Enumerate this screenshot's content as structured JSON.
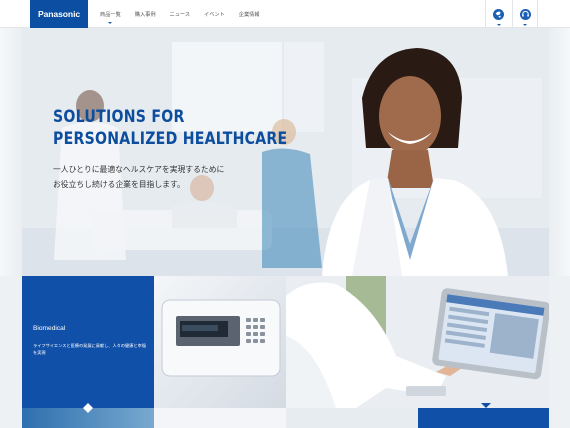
{
  "brand": {
    "logo_text": "Panasonic",
    "color": "#0b4ea2"
  },
  "nav": {
    "items": [
      {
        "label": "商品一覧",
        "has_dropdown": true
      },
      {
        "label": "購入事例",
        "has_dropdown": false
      },
      {
        "label": "ニュース",
        "has_dropdown": false
      },
      {
        "label": "イベント",
        "has_dropdown": false
      },
      {
        "label": "企業情報",
        "has_dropdown": false
      }
    ]
  },
  "header_buttons": [
    {
      "icon": "globe-icon"
    },
    {
      "icon": "contact-icon"
    }
  ],
  "hero": {
    "title_lines": [
      "SOLUTIONS FOR",
      "PERSONALIZED HEALTHCARE"
    ],
    "subtitle_lines": [
      "一人ひとりに最適なヘルスケアを実現するために",
      "お役立ちし続ける企業を目指します。"
    ],
    "title_color": "#0c4d9e"
  },
  "tiles": [
    {
      "title": "Biomedical",
      "description": "ライフサイエンスと医療の発展に貢献し、人々の健康と幸福を実現",
      "color": "#1150a8"
    }
  ]
}
